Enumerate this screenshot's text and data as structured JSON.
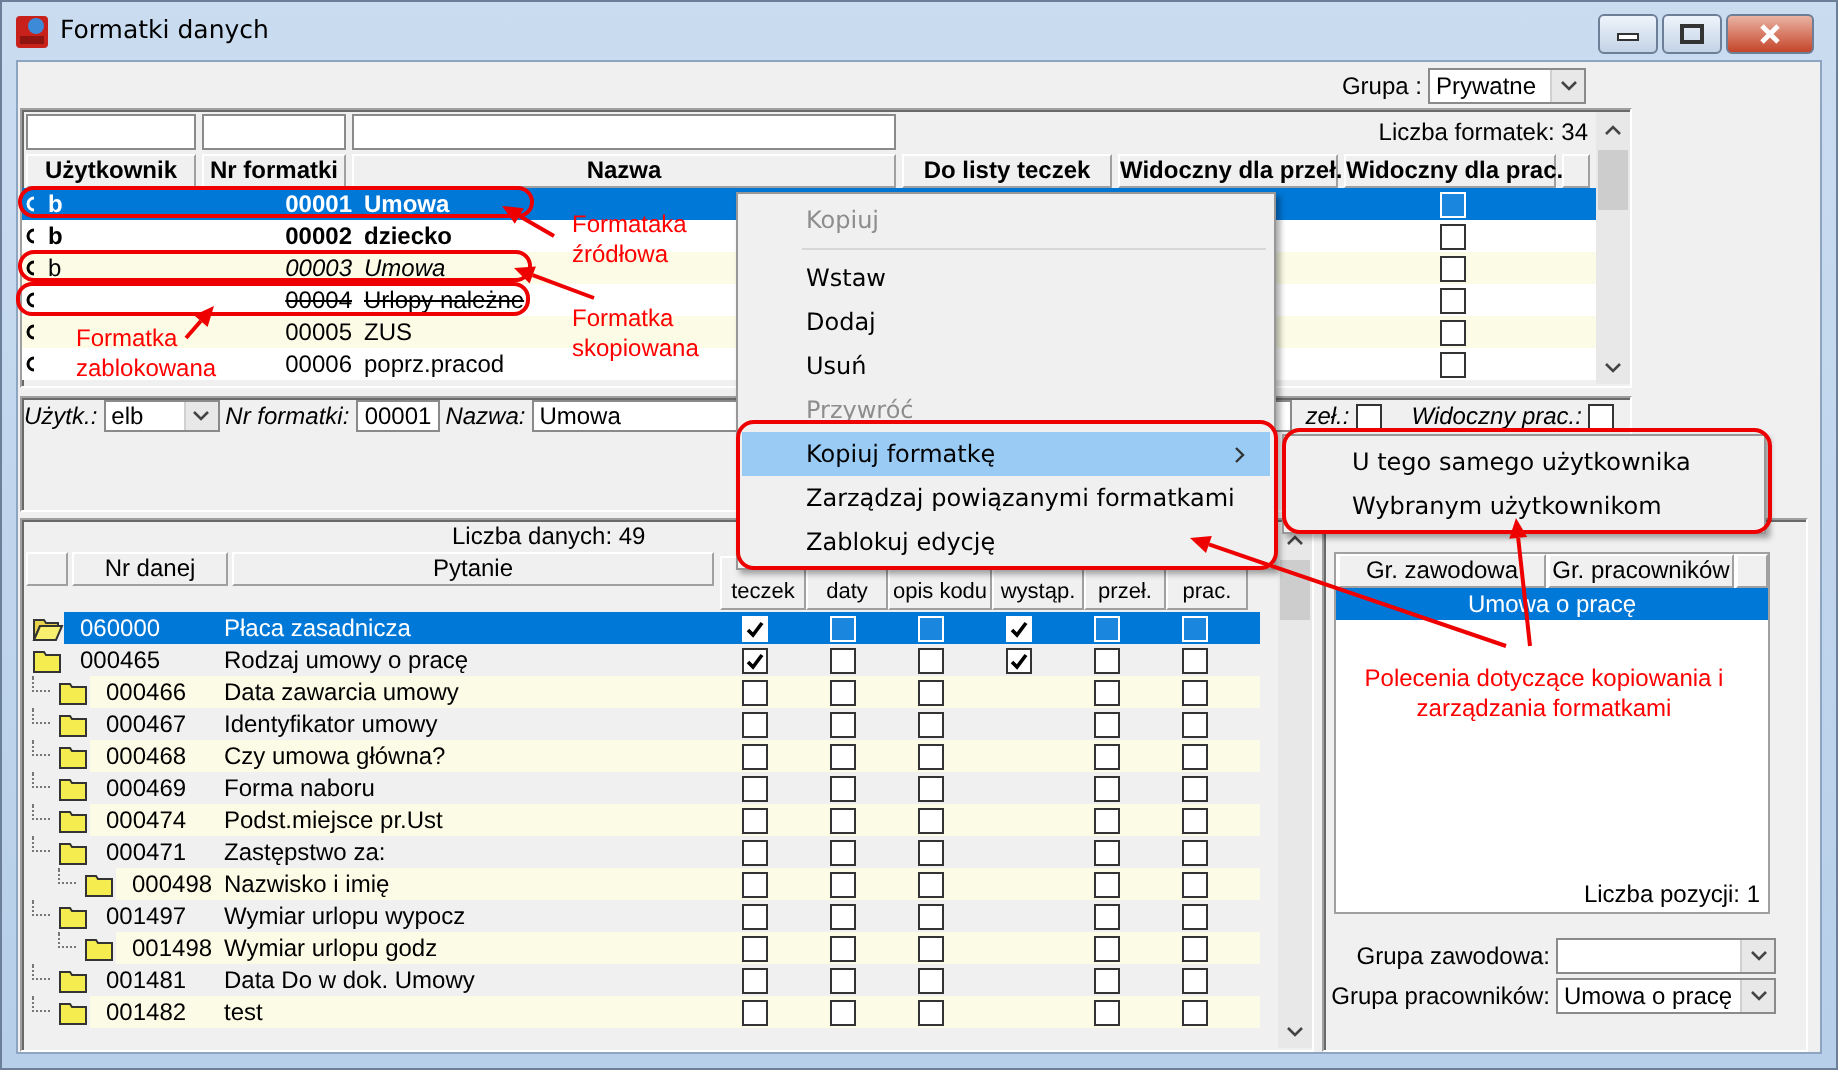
{
  "window": {
    "title": "Formatki danych"
  },
  "group_filter": {
    "label": "Grupa :",
    "value": "Prywatne"
  },
  "templates_table": {
    "count_label": "Liczba formatek: 34",
    "columns": [
      {
        "label": "Użytkownik"
      },
      {
        "label": "Nr formatki"
      },
      {
        "label": "Nazwa"
      },
      {
        "label": "Do listy teczek"
      },
      {
        "label": "Widoczny dla przeł."
      },
      {
        "label": "Widoczny dla prac."
      }
    ],
    "rows": [
      {
        "user": "b",
        "number": "00001",
        "name": "Umowa",
        "kind": "bold",
        "selected": true,
        "visible_prac": false
      },
      {
        "user": "b",
        "number": "00002",
        "name": "dziecko",
        "kind": "bold",
        "selected": false,
        "visible_prac": false
      },
      {
        "user": "b",
        "number": "00003",
        "name": "Umowa",
        "kind": "italic",
        "selected": false,
        "visible_prac": false
      },
      {
        "number": "00004",
        "name": "Urlopy należne",
        "kind": "struck",
        "selected": false,
        "visible_prac": false
      },
      {
        "number": "00005",
        "name": "ZUS",
        "kind": "plain",
        "selected": false,
        "visible_prac": false
      },
      {
        "number": "00006",
        "name": "poprz.pracod",
        "kind": "plain",
        "selected": false,
        "visible_prac": false
      }
    ]
  },
  "edit_bar": {
    "user_label": "Użytk.:",
    "user": "elb",
    "number_label": "Nr formatki:",
    "number": "00001",
    "name_label": "Nazwa:",
    "name": "Umowa",
    "flag1_label": "zeł.:",
    "flag1_checked": false,
    "flag2_label": "Widoczny prac.:",
    "flag2_checked": false
  },
  "data_table": {
    "count_label": "Liczba danych: 49",
    "columns": [
      {
        "label": "Nr danej",
        "kind": "text"
      },
      {
        "label": "Pytanie",
        "kind": "text"
      },
      {
        "label": "teczek",
        "kind": "check"
      },
      {
        "label": "daty",
        "kind": "check"
      },
      {
        "label": "opis kodu",
        "kind": "check"
      },
      {
        "label": "wystąp.",
        "kind": "check"
      },
      {
        "label": "przeł.",
        "kind": "check"
      },
      {
        "label": "prac.",
        "kind": "check"
      }
    ],
    "rows": [
      {
        "number": "060000",
        "question": "Płaca zasadnicza",
        "selected": true,
        "cells": [
          {
            "kind": "checkbox",
            "checked": true
          },
          {
            "kind": "checkbox",
            "checked": false
          },
          {
            "kind": "checkbox",
            "checked": false
          },
          {
            "kind": "checkbox",
            "checked": true
          },
          {
            "kind": "checkbox",
            "checked": false
          },
          {
            "kind": "checkbox",
            "checked": false
          }
        ]
      },
      {
        "number": "000465",
        "question": "Rodzaj umowy o pracę",
        "selected": false,
        "cells": [
          {
            "kind": "checkbox",
            "checked": true
          },
          {
            "kind": "checkbox",
            "checked": false
          },
          {
            "kind": "checkbox",
            "checked": false
          },
          {
            "kind": "checkbox",
            "checked": true
          },
          {
            "kind": "checkbox",
            "checked": false
          },
          {
            "kind": "checkbox",
            "checked": false
          }
        ],
        "children": [
          {
            "number": "000466",
            "question": "Data zawarcia umowy",
            "selected": false,
            "cells": [
              {
                "kind": "checkbox",
                "checked": false
              },
              {
                "kind": "checkbox",
                "checked": false
              },
              {
                "kind": "checkbox",
                "checked": false
              },
              {
                "kind": "empty"
              },
              {
                "kind": "checkbox",
                "checked": false
              },
              {
                "kind": "checkbox",
                "checked": false
              }
            ]
          },
          {
            "number": "000467",
            "question": "Identyfikator umowy",
            "selected": false,
            "cells": [
              {
                "kind": "checkbox",
                "checked": false
              },
              {
                "kind": "checkbox",
                "checked": false
              },
              {
                "kind": "checkbox",
                "checked": false
              },
              {
                "kind": "empty"
              },
              {
                "kind": "checkbox",
                "checked": false
              },
              {
                "kind": "checkbox",
                "checked": false
              }
            ]
          },
          {
            "number": "000468",
            "question": "Czy umowa główna?",
            "selected": false,
            "cells": [
              {
                "kind": "checkbox",
                "checked": false
              },
              {
                "kind": "checkbox",
                "checked": false
              },
              {
                "kind": "checkbox",
                "checked": false
              },
              {
                "kind": "empty"
              },
              {
                "kind": "checkbox",
                "checked": false
              },
              {
                "kind": "checkbox",
                "checked": false
              }
            ]
          },
          {
            "number": "000469",
            "question": "Forma naboru",
            "selected": false,
            "cells": [
              {
                "kind": "checkbox",
                "checked": false
              },
              {
                "kind": "checkbox",
                "checked": false
              },
              {
                "kind": "checkbox",
                "checked": false
              },
              {
                "kind": "empty"
              },
              {
                "kind": "checkbox",
                "checked": false
              },
              {
                "kind": "checkbox",
                "checked": false
              }
            ]
          },
          {
            "number": "000474",
            "question": "Podst.miejsce pr.Ust",
            "selected": false,
            "cells": [
              {
                "kind": "checkbox",
                "checked": false
              },
              {
                "kind": "checkbox",
                "checked": false
              },
              {
                "kind": "checkbox",
                "checked": false
              },
              {
                "kind": "empty"
              },
              {
                "kind": "checkbox",
                "checked": false
              },
              {
                "kind": "checkbox",
                "checked": false
              }
            ]
          },
          {
            "number": "000471",
            "question": "Zastępstwo za:",
            "selected": false,
            "cells": [
              {
                "kind": "checkbox",
                "checked": false
              },
              {
                "kind": "checkbox",
                "checked": false
              },
              {
                "kind": "checkbox",
                "checked": false
              },
              {
                "kind": "empty"
              },
              {
                "kind": "checkbox",
                "checked": false
              },
              {
                "kind": "checkbox",
                "checked": false
              }
            ],
            "children": [
              {
                "number": "000498",
                "question": "Nazwisko i imię",
                "selected": false,
                "cells": [
                  {
                    "kind": "checkbox",
                    "checked": false
                  },
                  {
                    "kind": "checkbox",
                    "checked": false
                  },
                  {
                    "kind": "checkbox",
                    "checked": false
                  },
                  {
                    "kind": "empty"
                  },
                  {
                    "kind": "checkbox",
                    "checked": false
                  },
                  {
                    "kind": "checkbox",
                    "checked": false
                  }
                ]
              }
            ]
          },
          {
            "number": "001497",
            "question": "Wymiar urlopu wypocz",
            "selected": false,
            "cells": [
              {
                "kind": "checkbox",
                "checked": false
              },
              {
                "kind": "checkbox",
                "checked": false
              },
              {
                "kind": "checkbox",
                "checked": false
              },
              {
                "kind": "empty"
              },
              {
                "kind": "checkbox",
                "checked": false
              },
              {
                "kind": "checkbox",
                "checked": false
              }
            ],
            "children": [
              {
                "number": "001498",
                "question": "Wymiar urlopu godz",
                "selected": false,
                "cells": [
                  {
                    "kind": "checkbox",
                    "checked": false
                  },
                  {
                    "kind": "checkbox",
                    "checked": false
                  },
                  {
                    "kind": "checkbox",
                    "checked": false
                  },
                  {
                    "kind": "empty"
                  },
                  {
                    "kind": "checkbox",
                    "checked": false
                  },
                  {
                    "kind": "checkbox",
                    "checked": false
                  }
                ]
              }
            ]
          },
          {
            "number": "001481",
            "question": "Data Do w dok. Umowy",
            "selected": false,
            "cells": [
              {
                "kind": "checkbox",
                "checked": false
              },
              {
                "kind": "checkbox",
                "checked": false
              },
              {
                "kind": "checkbox",
                "checked": false
              },
              {
                "kind": "empty"
              },
              {
                "kind": "checkbox",
                "checked": false
              },
              {
                "kind": "checkbox",
                "checked": false
              }
            ]
          },
          {
            "number": "001482",
            "question": "test",
            "selected": false,
            "cells": [
              {
                "kind": "checkbox",
                "checked": false
              },
              {
                "kind": "checkbox",
                "checked": false
              },
              {
                "kind": "checkbox",
                "checked": false
              },
              {
                "kind": "empty"
              },
              {
                "kind": "checkbox",
                "checked": false
              },
              {
                "kind": "checkbox",
                "checked": false
              }
            ]
          }
        ]
      }
    ]
  },
  "groups_panel": {
    "columns": [
      "Gr. zawodowa",
      "Gr. pracowników"
    ],
    "rows": [
      {
        "text": "Umowa o pracę",
        "selected": true
      }
    ],
    "count_label": "Liczba pozycji: 1",
    "fields": [
      {
        "label": "Grupa zawodowa:"
      },
      {
        "label": "Grupa pracowników:",
        "value": "Umowa o pracę"
      }
    ]
  },
  "context_menu": {
    "items": [
      {
        "kind": "item",
        "label": "Kopiuj",
        "disabled": true,
        "selected": false
      },
      {
        "kind": "separator"
      },
      {
        "kind": "item",
        "label": "Wstaw",
        "disabled": false,
        "selected": false
      },
      {
        "kind": "item",
        "label": "Dodaj",
        "disabled": false,
        "selected": false
      },
      {
        "kind": "item",
        "label": "Usuń",
        "disabled": false,
        "selected": false
      },
      {
        "kind": "item",
        "label": "Przywróć",
        "disabled": true,
        "selected": false
      },
      {
        "kind": "item",
        "label": "Kopiuj formatkę",
        "disabled": false,
        "selected": true,
        "submenu": true
      },
      {
        "kind": "item",
        "label": "Zarządzaj powiązanymi formatkami",
        "disabled": false,
        "selected": false
      },
      {
        "kind": "item",
        "label": "Zablokuj edycję",
        "disabled": false,
        "selected": false
      }
    ]
  },
  "submenu": {
    "items": [
      {
        "label": "U tego samego użytkownika",
        "selected": false
      },
      {
        "label": "Wybranym użytkownikom",
        "selected": false
      }
    ]
  },
  "annotations": [
    {
      "text": "Formataka źródłowa"
    },
    {
      "text": "Formatka skopiowana"
    },
    {
      "text": "Formatka zablokowana"
    },
    {
      "text": "Polecenia dotyczące kopiowania i zarządzania formatkami"
    }
  ]
}
